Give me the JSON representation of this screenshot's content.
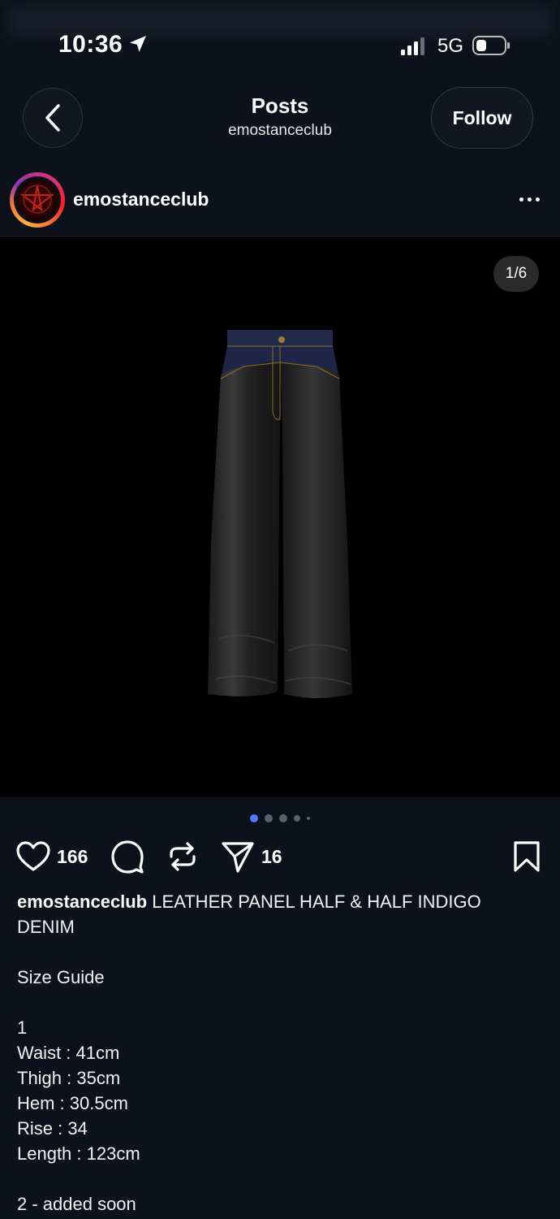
{
  "status_bar": {
    "time": "10:36",
    "network": "5G",
    "icons": [
      "location-arrow-icon",
      "cellular-signal-icon",
      "battery-icon"
    ]
  },
  "header": {
    "back_icon": "chevron-left-icon",
    "title": "Posts",
    "subtitle": "emostanceclub",
    "follow_label": "Follow"
  },
  "post": {
    "username": "emostanceclub",
    "media_counter": "1/6",
    "carousel": {
      "total_dots": 5,
      "active_index": 0
    },
    "likes": "166",
    "shares": "16",
    "caption": {
      "username": "emostanceclub",
      "title": "LEATHER PANEL HALF & HALF INDIGO DENIM",
      "size_guide_label": "Size Guide",
      "size_1": {
        "label": "1",
        "waist": "Waist : 41cm",
        "thigh": "Thigh : 35cm",
        "hem": "Hem : 30.5cm",
        "rise": "Rise : 34",
        "length": "Length : 123cm"
      },
      "size_2": "2 - added soon"
    }
  },
  "colors": {
    "background": "#0d111c",
    "media_background": "#000000",
    "active_dot": "#4f7cff",
    "text": "#f5f5f5"
  }
}
